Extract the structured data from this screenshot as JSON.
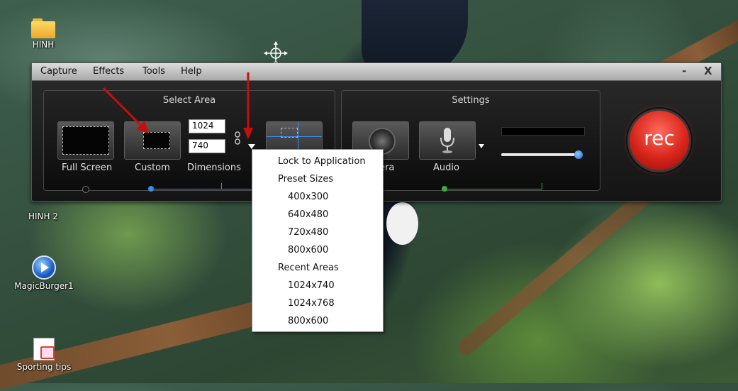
{
  "desktop": {
    "icons": [
      {
        "label": "HINH"
      },
      {
        "label": "HINH 2"
      },
      {
        "label": "MagicBurger1"
      },
      {
        "label": "Sporting tips"
      }
    ]
  },
  "window": {
    "menu": [
      "Capture",
      "Effects",
      "Tools",
      "Help"
    ],
    "minimize": "-",
    "close": "X"
  },
  "select_area": {
    "title": "Select Area",
    "full_screen_label": "Full Screen",
    "custom_label": "Custom",
    "dimensions_label": "Dimensions",
    "width_value": "1024",
    "height_value": "740"
  },
  "settings": {
    "title": "Settings",
    "camera_label": "era",
    "audio_label": "Audio"
  },
  "rec_label": "rec",
  "dropdown": {
    "items": [
      {
        "label": "Lock to Application",
        "indent": false
      },
      {
        "label": "Preset Sizes",
        "indent": false
      },
      {
        "label": "400x300",
        "indent": true
      },
      {
        "label": "640x480",
        "indent": true
      },
      {
        "label": "720x480",
        "indent": true
      },
      {
        "label": "800x600",
        "indent": true
      },
      {
        "label": "Recent Areas",
        "indent": false
      },
      {
        "label": "1024x740",
        "indent": true
      },
      {
        "label": "1024x768",
        "indent": true
      },
      {
        "label": "800x600",
        "indent": true
      }
    ]
  },
  "colors": {
    "accent_blue": "#3a8ee6",
    "accent_green": "#3faa3f",
    "annotation_red": "#c4100c",
    "rec_red": "#d7241a"
  }
}
